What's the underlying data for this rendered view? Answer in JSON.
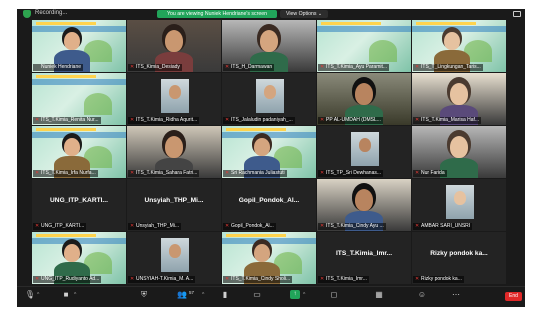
{
  "topbar": {
    "left_label": "Recording...",
    "viewing_banner": "You are viewing Nuniek Hendriane's screen",
    "view_options": "View Options ⌄"
  },
  "participants": [
    {
      "name": "Nuniek Hendriane",
      "kind": "slide",
      "mic": "on",
      "active": true
    },
    {
      "name": "ITS_Kimia_Desiady",
      "kind": "person",
      "mic": "off"
    },
    {
      "name": "ITS_H_Darmawan",
      "kind": "person",
      "mic": "off"
    },
    {
      "name": "ITS_T.Kimia_Ayu Paramit...",
      "kind": "slide",
      "mic": "off"
    },
    {
      "name": "ITS_T_Lingkungan_Taris...",
      "kind": "slide",
      "mic": "off"
    },
    {
      "name": "ITS_T.Kimia_Renita Nur...",
      "kind": "slide",
      "mic": "off"
    },
    {
      "name": "ITS_T.Kimia_Ridha Aqurit...",
      "kind": "photo",
      "mic": "off"
    },
    {
      "name": "ITS_Jalaludin padaniyah_...",
      "kind": "photo",
      "mic": "off"
    },
    {
      "name": "PP AL-UMDAH (DMSL...",
      "kind": "room",
      "mic": "off"
    },
    {
      "name": "ITS_T.Kimia_Marisa Haf...",
      "kind": "person",
      "mic": "off"
    },
    {
      "name": "ITS_T.Kimia_Irfa Nurfa...",
      "kind": "slide",
      "mic": "off"
    },
    {
      "name": "ITS_T.Kimia_Sahara Fatri...",
      "kind": "person",
      "mic": "off"
    },
    {
      "name": "Sri Rachmania Juliastuti",
      "kind": "slide",
      "mic": "off"
    },
    {
      "name": "ITS_TP_Sri Dewhanas...",
      "kind": "photo",
      "mic": "off"
    },
    {
      "name": "Nur Farida",
      "kind": "person",
      "mic": "off"
    },
    {
      "name": "UNG_ITP_KARTI...",
      "kind": "name",
      "mic": "off"
    },
    {
      "name": "Unsyiah_THP_Mi...",
      "kind": "name",
      "mic": "off"
    },
    {
      "name": "Gopil_Pondok_Al...",
      "kind": "name",
      "mic": "off"
    },
    {
      "name": "ITS_T.Kimia_Cindy Ayu ...",
      "kind": "person",
      "mic": "off"
    },
    {
      "name": "AMBAR SARI_UNSRI",
      "kind": "photo",
      "mic": "off"
    },
    {
      "name": "UNG_ITP_Rudiyanto Ad...",
      "kind": "slide",
      "mic": "off"
    },
    {
      "name": "UNSYIAH-T.Kimia_M. A...",
      "kind": "photo",
      "mic": "off"
    },
    {
      "name": "ITS_T.Kimia_Cindy Sholi...",
      "kind": "slide",
      "mic": "off"
    },
    {
      "name": "ITS_T.Kimia_Imr...",
      "kind": "name",
      "mic": "off"
    },
    {
      "name": "Rizky pondok ka...",
      "kind": "name",
      "mic": "off"
    }
  ],
  "toolbar": {
    "participants_count": "57",
    "end_label": "End"
  },
  "colors": {
    "active_border": "#5cd65c",
    "share_green": "#21a45a",
    "end_red": "#e02828",
    "mic_off": "#e53935"
  }
}
